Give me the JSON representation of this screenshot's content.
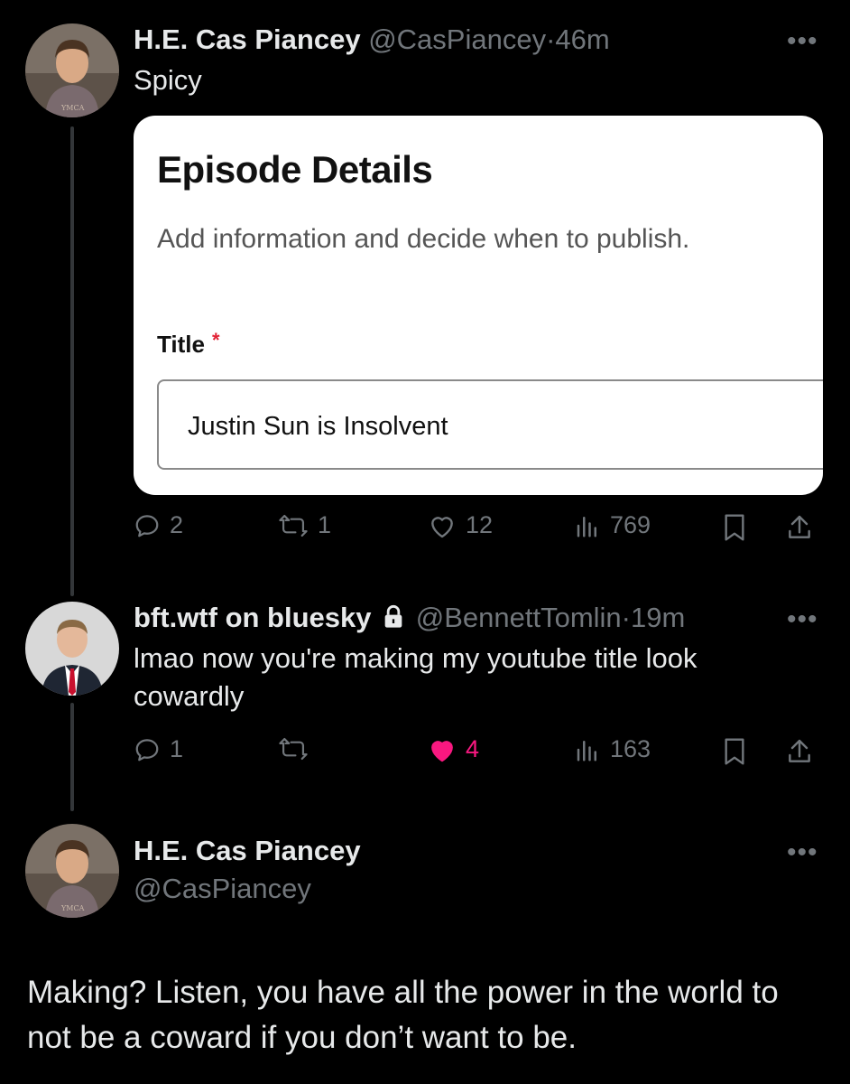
{
  "tweets": [
    {
      "author_name": "H.E. Cas Piancey",
      "author_handle": "@CasPiancey",
      "time_sep": "·",
      "time": "46m",
      "text": "Spicy",
      "card": {
        "title": "Episode Details",
        "subtitle": "Add information and decide when to publish.",
        "field_label": "Title",
        "required_mark": "*",
        "field_value": "Justin Sun is Insolvent"
      },
      "actions": {
        "replies": "2",
        "retweets": "1",
        "likes": "12",
        "views": "769"
      }
    },
    {
      "author_name": "bft.wtf on bluesky",
      "author_handle": "@BennettTomlin",
      "time_sep": "·",
      "time": "19m",
      "text": "lmao now you're making my youtube title look cowardly",
      "actions": {
        "replies": "1",
        "retweets": "",
        "likes": "4",
        "views": "163"
      }
    },
    {
      "author_name": "H.E. Cas Piancey",
      "author_handle": "@CasPiancey",
      "text": "Making? Listen, you have all the power in the world to not be a coward if you don’t want to be."
    }
  ],
  "more_label": "•••",
  "colors": {
    "background": "#000000",
    "muted": "#71767b",
    "liked": "#f91880",
    "thread_line": "#333639"
  }
}
